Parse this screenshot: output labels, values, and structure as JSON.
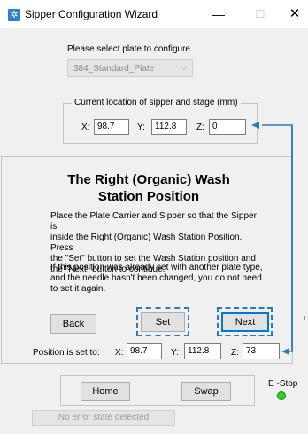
{
  "window": {
    "title": "Sipper Configuration Wizard",
    "minimize_symbol": "—",
    "maximize_symbol": "☐",
    "close_symbol": "✕"
  },
  "plate": {
    "prompt": "Please select plate to configure",
    "selected": "384_Standard_Plate"
  },
  "current_location": {
    "legend": "Current location of sipper and stage (mm)",
    "x_label": "X:",
    "x_value": "98.7",
    "y_label": "Y:",
    "y_value": "112.8",
    "z_label": "Z:",
    "z_value": "0"
  },
  "step": {
    "heading_line1": "The Right (Organic) Wash",
    "heading_line2": "Station Position",
    "instructions": [
      "Place the Plate Carrier and Sipper so that the Sipper is",
      "inside the Right (Organic) Wash Station Position. Press",
      "the \"Set\" button to set the Wash Station position and",
      "the \"Next\" button to continue."
    ],
    "note": [
      "If this position was already set with another plate type,",
      "and the needle hasn't been changed, you do not need",
      "to set it again."
    ]
  },
  "buttons": {
    "back": "Back",
    "set": "Set",
    "next": "Next",
    "home": "Home",
    "swap": "Swap"
  },
  "position_set": {
    "label": "Position is set to:",
    "x_label": "X:",
    "x_value": "98.7",
    "y_label": "Y:",
    "y_value": "112.8",
    "z_label": "Z:",
    "z_value": "73"
  },
  "estop": {
    "label": "E -Stop"
  },
  "status": {
    "text": "No error state detected"
  },
  "colors": {
    "annotation_blue": "#2b7bbf",
    "estop_green": "#2ad51a",
    "app_icon_blue": "#2d7fd2"
  }
}
